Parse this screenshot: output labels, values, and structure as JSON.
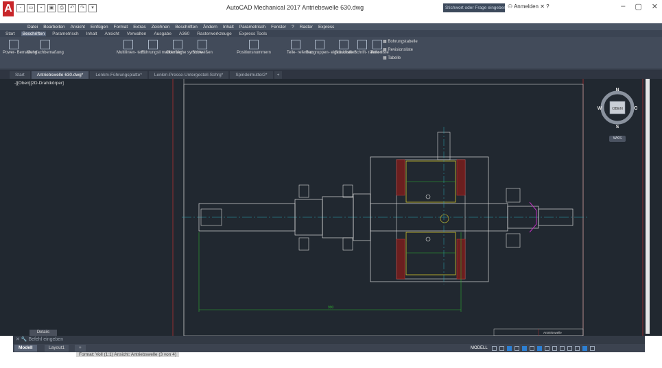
{
  "app": {
    "logo": "A",
    "title": "AutoCAD Mechanical 2017   Antriebswelle 630.dwg",
    "search_placeholder": "Stichwort oder Frage eingeben",
    "login": "Anmelden"
  },
  "menubar": [
    "Datei",
    "Bearbeiten",
    "Ansicht",
    "Einfügen",
    "Format",
    "Extras",
    "Zeichnen",
    "Beschriften",
    "Ändern",
    "Inhalt",
    "Parametrisch",
    "Fenster",
    "?",
    "Raster",
    "Express"
  ],
  "ribbon_tabs": [
    {
      "label": "Start",
      "active": false
    },
    {
      "label": "Beschriften",
      "active": true
    },
    {
      "label": "Parametrisch",
      "active": false
    },
    {
      "label": "Inhalt",
      "active": false
    },
    {
      "label": "Ansicht",
      "active": false
    },
    {
      "label": "Verwalten",
      "active": false
    },
    {
      "label": "Ausgabe",
      "active": false
    },
    {
      "label": "A360",
      "active": false
    },
    {
      "label": "Rasterwerkzeuge",
      "active": false
    },
    {
      "label": "Express Tools",
      "active": false
    }
  ],
  "ribbon_tools": {
    "power_dim": "Power-\nBemaßung",
    "multi_dim": "Mehrfachbemaßung",
    "multiline_text": "Multilinien-\ntext",
    "leader": "Führungsli\nmarkierung",
    "surface": "Oberfläche\nsymbole",
    "weld": "Schweißen",
    "position": "Positionsnummern",
    "part_ref": "Teile-\nreferenz",
    "group_props": "Baugruppen-\neigenschaften",
    "bom": "Stückliste",
    "title_block": "Schrift-\nrahmen",
    "parts_list": "Teile-\nliste",
    "bom_table": "Bohrungstabelle",
    "revision": "Revisionsliste",
    "table": "Tabelle"
  },
  "file_tabs": [
    {
      "label": "Start",
      "active": false
    },
    {
      "label": "Antriebswelle 630.dwg*",
      "active": true
    },
    {
      "label": "Lenkm-Führungsplatte*",
      "active": false
    },
    {
      "label": "Lenkm-Presse-Untergestell-Schrg*",
      "active": false
    },
    {
      "label": "Spindelmutter2*",
      "active": false
    }
  ],
  "viewport_label": "-][Oben][2D-Drahtkörper]",
  "viewcube": {
    "north": "N",
    "south": "S",
    "east": "O",
    "west": "W",
    "face": "OBEN",
    "wcs": "WKS"
  },
  "drawing": {
    "dimension_text": "990",
    "title_text": "Antriebswelle"
  },
  "command": {
    "details_label": "Details",
    "prompt": "Befehl eingeben"
  },
  "layout_tabs": [
    {
      "label": "Modell",
      "active": true
    },
    {
      "label": "Layout1",
      "active": false
    }
  ],
  "status": {
    "modell": "MODELL"
  },
  "overlay_info": "Format: Voll (1:1)    Ansicht: Antriebswelle  (3 von 4)"
}
